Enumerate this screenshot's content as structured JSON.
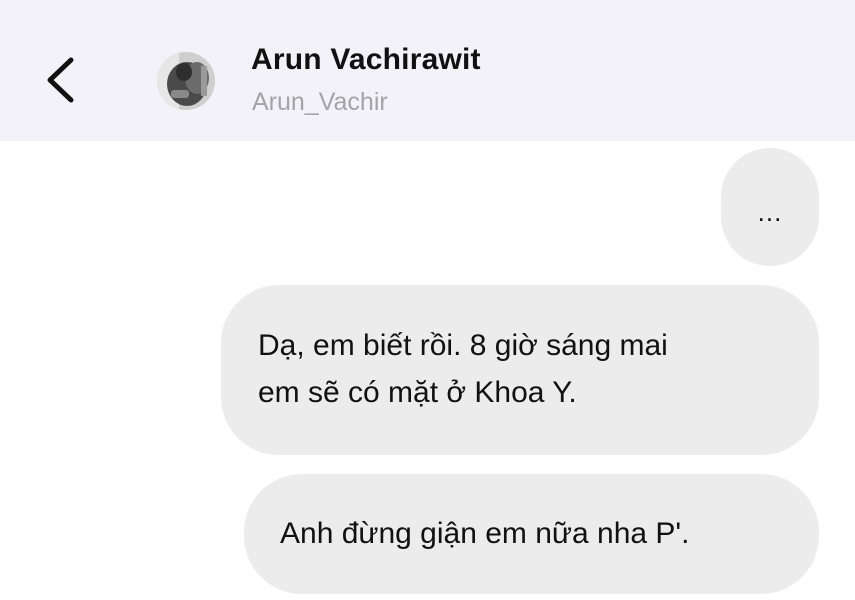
{
  "header": {
    "back_icon": "chevron-left-icon",
    "contact_name": "Arun Vachirawit",
    "contact_handle": "Arun_Vachir",
    "background_color": "#f3f2f8"
  },
  "messages": [
    {
      "text": "...",
      "lines": [
        "..."
      ]
    },
    {
      "text": "Dạ, em biết rồi. 8 giờ sáng mai em sẽ có mặt ở Khoa Y.",
      "lines": [
        "Dạ, em biết rồi. 8 giờ sáng mai",
        "em sẽ có mặt ở Khoa Y."
      ]
    },
    {
      "text": "Anh đừng giận em nữa nha P'.",
      "lines": [
        "Anh đừng giận em nữa nha P'."
      ]
    }
  ],
  "colors": {
    "bubble": "#ececec",
    "text": "#111111",
    "handle": "#a3a3a8"
  }
}
